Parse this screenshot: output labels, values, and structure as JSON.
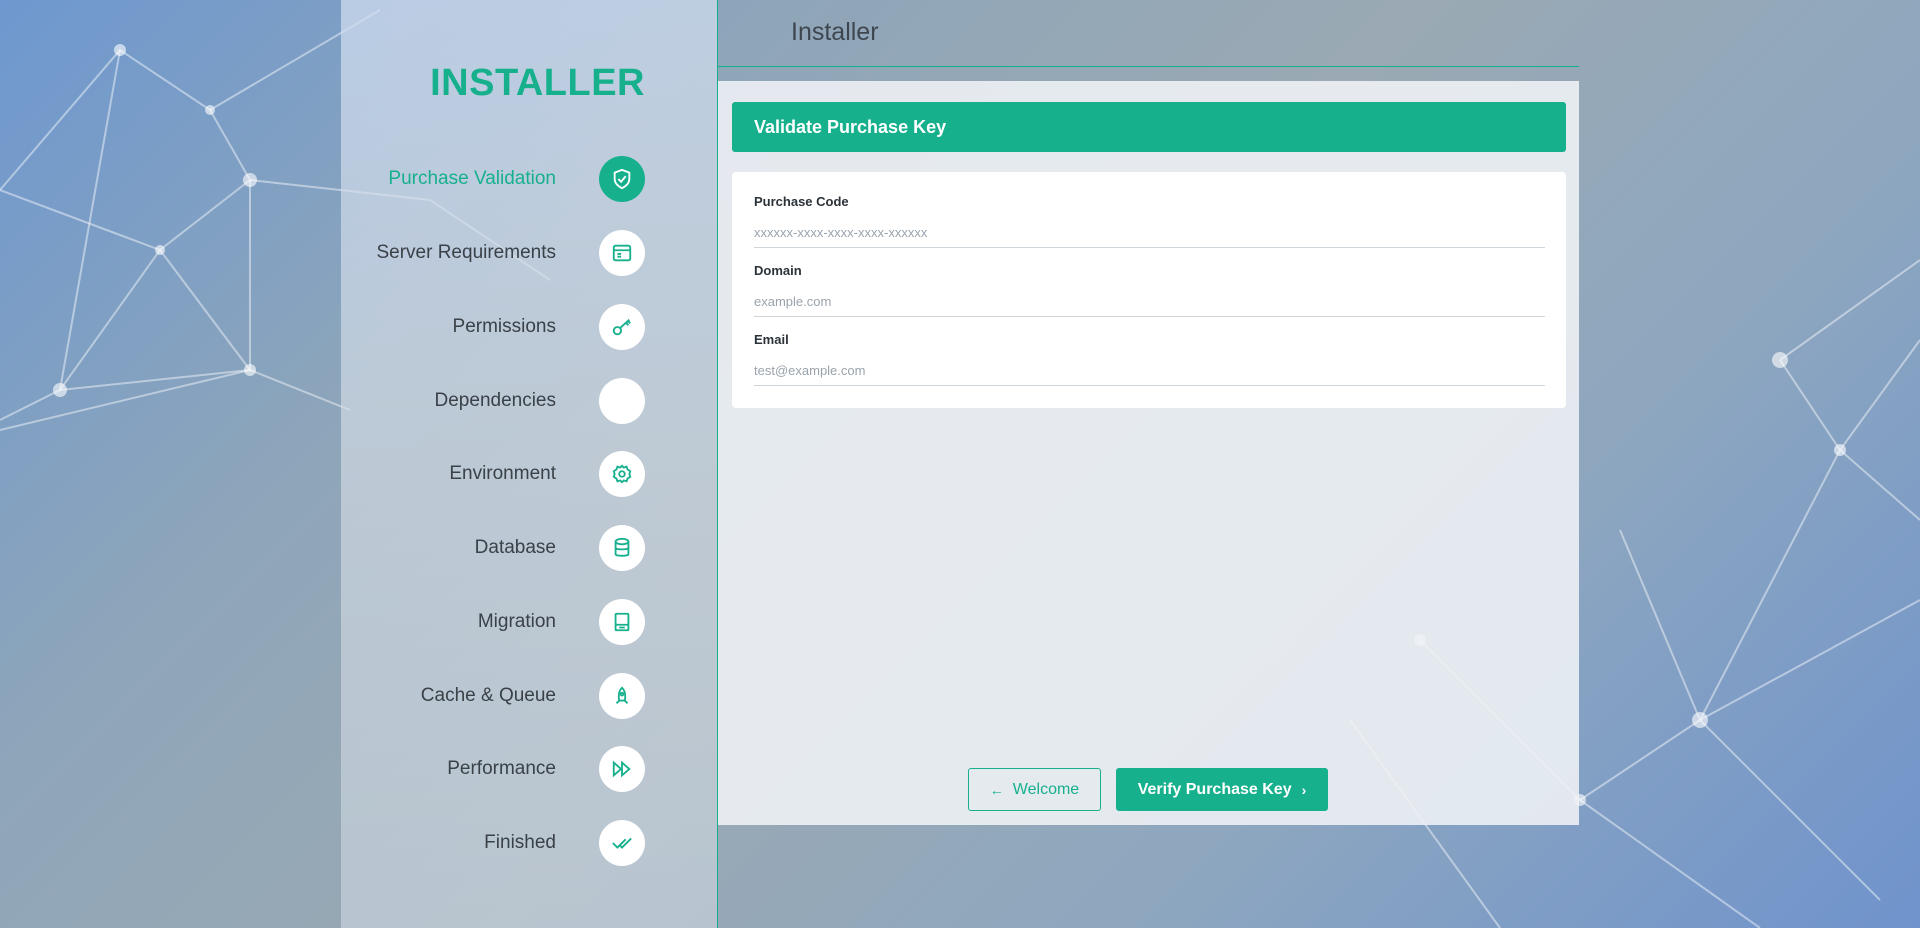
{
  "header": {
    "title": "Installer"
  },
  "sidebar": {
    "brand": "INSTALLER",
    "steps": [
      {
        "label": "Purchase Validation",
        "icon": "shield-check-icon",
        "active": true
      },
      {
        "label": "Server Requirements",
        "icon": "browser-window-icon"
      },
      {
        "label": "Permissions",
        "icon": "key-icon"
      },
      {
        "label": "Dependencies",
        "icon": "blank-icon"
      },
      {
        "label": "Environment",
        "icon": "gear-icon"
      },
      {
        "label": "Database",
        "icon": "database-icon"
      },
      {
        "label": "Migration",
        "icon": "drive-icon"
      },
      {
        "label": "Cache & Queue",
        "icon": "rocket-icon"
      },
      {
        "label": "Performance",
        "icon": "fast-forward-icon"
      },
      {
        "label": "Finished",
        "icon": "double-check-icon"
      }
    ]
  },
  "main": {
    "heading": "Validate Purchase Key",
    "fields": [
      {
        "label": "Purchase Code",
        "placeholder": "xxxxxx-xxxx-xxxx-xxxx-xxxxxx",
        "value": ""
      },
      {
        "label": "Domain",
        "placeholder": "example.com",
        "value": ""
      },
      {
        "label": "Email",
        "placeholder": "test@example.com",
        "value": ""
      }
    ],
    "back_button": "Welcome",
    "next_button": "Verify Purchase Key"
  },
  "colors": {
    "accent": "#16b08d",
    "text": "#3a4148"
  }
}
